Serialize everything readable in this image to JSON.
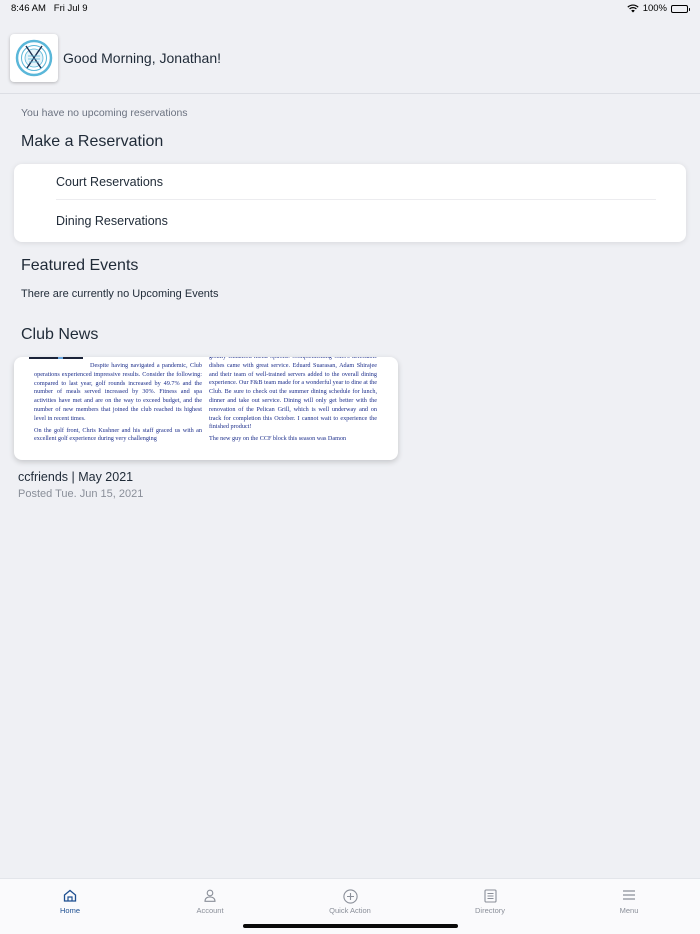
{
  "status_bar": {
    "time": "8:46 AM",
    "date": "Fri Jul 9",
    "battery": "100%"
  },
  "header": {
    "greeting": "Good Morning, Jonathan!"
  },
  "reservations": {
    "empty_message": "You have no upcoming reservations",
    "section_title": "Make a Reservation",
    "items": [
      "Court Reservations",
      "Dining Reservations"
    ]
  },
  "events": {
    "section_title": "Featured Events",
    "empty_message": "There are currently no Upcoming Events"
  },
  "news": {
    "section_title": "Club News",
    "article": {
      "title": "ccfriends | May 2021",
      "posted": "Posted Tue. Jun 15, 2021",
      "preview_left_1": "Despite having navigated a pandemic, Club operations experienced impressive results. Consider the following: compared to last year, golf rounds increased by 49.7% and the number of meals served increased by 30%. Fitness and spa activities have met and are on the way to exceed budget, and the number of new members that joined the club reached its highest level in recent times.",
      "preview_left_2": "On the golf front, Chris Kushner and his staff graced us with an excellent golf experience during very challenging",
      "preview_right_1": "greatly enhanced menu options. Complementing Chef's delectable dishes came with great service. Eduard Suarasan, Adam Shirajee and their team of well-trained servers added to the overall dining experience. Our F&B team made for a wonderful year to dine at the Club. Be sure to check out the summer dining schedule for lunch, dinner and take out service. Dining will only get better with the renovation of the Pelican Grill, which is well underway and on track for completion this October. I cannot wait to experience the finished product!",
      "preview_right_2": "The new guy on the CCF block this season was Damon"
    }
  },
  "tab_bar": {
    "tabs": [
      {
        "label": "Home",
        "icon": "home-icon",
        "active": true
      },
      {
        "label": "Account",
        "icon": "person-icon",
        "active": false
      },
      {
        "label": "Quick Action",
        "icon": "plus-circle-icon",
        "active": false
      },
      {
        "label": "Directory",
        "icon": "list-icon",
        "active": false
      },
      {
        "label": "Menu",
        "icon": "hamburger-icon",
        "active": false
      }
    ]
  },
  "colors": {
    "background": "#eff0f4",
    "active_tab": "#1d4f91",
    "inactive_tab": "#8a8f99",
    "newsletter_text": "#1b2d8a"
  }
}
